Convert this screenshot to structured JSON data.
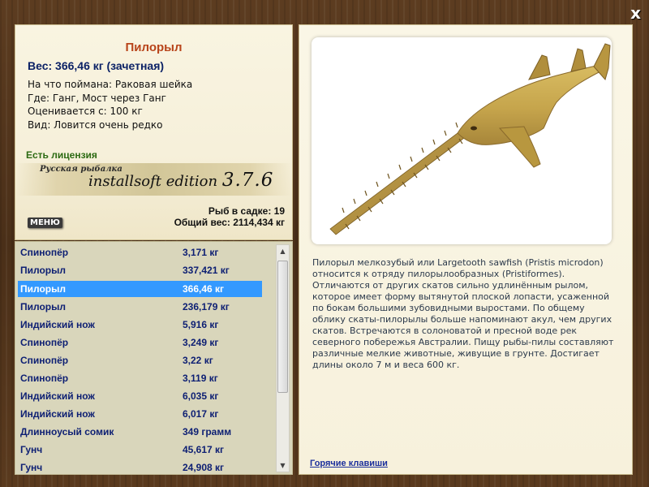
{
  "window": {
    "close_glyph": "x"
  },
  "fish_card": {
    "title": "Пилорыл",
    "weight_line": "Вес: 366,46 кг (зачетная)",
    "info_lines": [
      "На что поймана: Раковая шейка",
      "Где: Ганг, Мост через Ганг",
      "Оценивается с: 100 кг",
      "Вид: Ловится очень редко"
    ],
    "license": "Есть лицензия",
    "logo_small": "Русская рыбалка",
    "logo_main": "installsoft edition",
    "logo_version": "3.7.6",
    "menu_label": "МЕНЮ",
    "fish_count_text": "Рыб в садке: 19",
    "total_weight_text": "Общий вес: 2114,434 кг"
  },
  "catch_list": {
    "selected_index": 2,
    "rows": [
      {
        "name": "Спинопёр",
        "weight": "3,171 кг"
      },
      {
        "name": "Пилорыл",
        "weight": "337,421 кг"
      },
      {
        "name": "Пилорыл",
        "weight": "366,46 кг"
      },
      {
        "name": "Пилорыл",
        "weight": "236,179 кг"
      },
      {
        "name": "Индийский нож",
        "weight": "5,916 кг"
      },
      {
        "name": "Спинопёр",
        "weight": "3,249 кг"
      },
      {
        "name": "Спинопёр",
        "weight": "3,22 кг"
      },
      {
        "name": "Спинопёр",
        "weight": "3,119 кг"
      },
      {
        "name": "Индийский нож",
        "weight": "6,035 кг"
      },
      {
        "name": "Индийский нож",
        "weight": "6,017 кг"
      },
      {
        "name": "Длинноусый сомик",
        "weight": "349 грамм"
      },
      {
        "name": "Гунч",
        "weight": "45,617 кг"
      },
      {
        "name": "Гунч",
        "weight": "24,908 кг"
      }
    ],
    "scroll_up_icon": "▲",
    "scroll_down_icon": "▼"
  },
  "details": {
    "description": "Пилорыл мелкозубый или Largetooth sawfish (Pristis microdon) относится к отряду пилорылообразных (Pristiformes). Отличаются от других скатов сильно удлинённым рылом, которое имеет форму вытянутой плоской лопасти, усаженной по бокам большими зубовидными выростами. По общему облику скаты-пилорылы больше напоминают акул, чем других скатов. Встречаются в солоноватой и пресной воде рек северного побережья Австралии. Пищу рыбы-пилы составляют различные мелкие животные, живущие в грунте. Достигает длины около 7 м и веса 600 кг.",
    "hotkeys_link": "Горячие клавиши"
  },
  "colors": {
    "title": "#b8441a",
    "weight": "#0c2266",
    "license": "#2c6a12",
    "row_text": "#0d1f73",
    "selection": "#3399ff",
    "fish_body": "#c9a94e"
  }
}
